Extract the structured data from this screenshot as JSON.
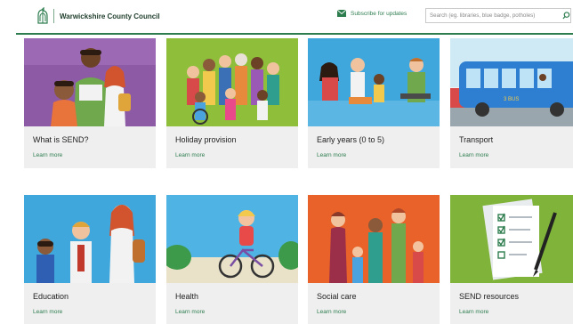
{
  "header": {
    "site_name": "Warwickshire County Council",
    "subscribe_label": "Subscribe for updates",
    "search_placeholder": "Search (eg. libraries, blue badge, potholes)"
  },
  "colors": {
    "brand_green": "#2e7d4f",
    "card_background": "#efefef",
    "title_text": "#222222"
  },
  "cards": [
    {
      "title": "What is SEND?",
      "link": "Learn more",
      "image": "family-illustration"
    },
    {
      "title": "Holiday provision",
      "link": "Learn more",
      "image": "crowd-illustration"
    },
    {
      "title": "Early years (0 to 5)",
      "link": "Learn more",
      "image": "parents-and-children-illustration"
    },
    {
      "title": "Transport",
      "link": "Learn more",
      "image": "bus-illustration"
    },
    {
      "title": "Education",
      "link": "Learn more",
      "image": "students-illustration"
    },
    {
      "title": "Health",
      "link": "Learn more",
      "image": "cyclist-illustration"
    },
    {
      "title": "Social care",
      "link": "Learn more",
      "image": "family-group-illustration"
    },
    {
      "title": "SEND resources",
      "link": "Learn more",
      "image": "checklist-clipboard-illustration"
    }
  ],
  "icons": {
    "logo": "bear-and-ragged-staff-crest-icon",
    "subscribe": "envelope-icon",
    "search": "search-icon"
  }
}
